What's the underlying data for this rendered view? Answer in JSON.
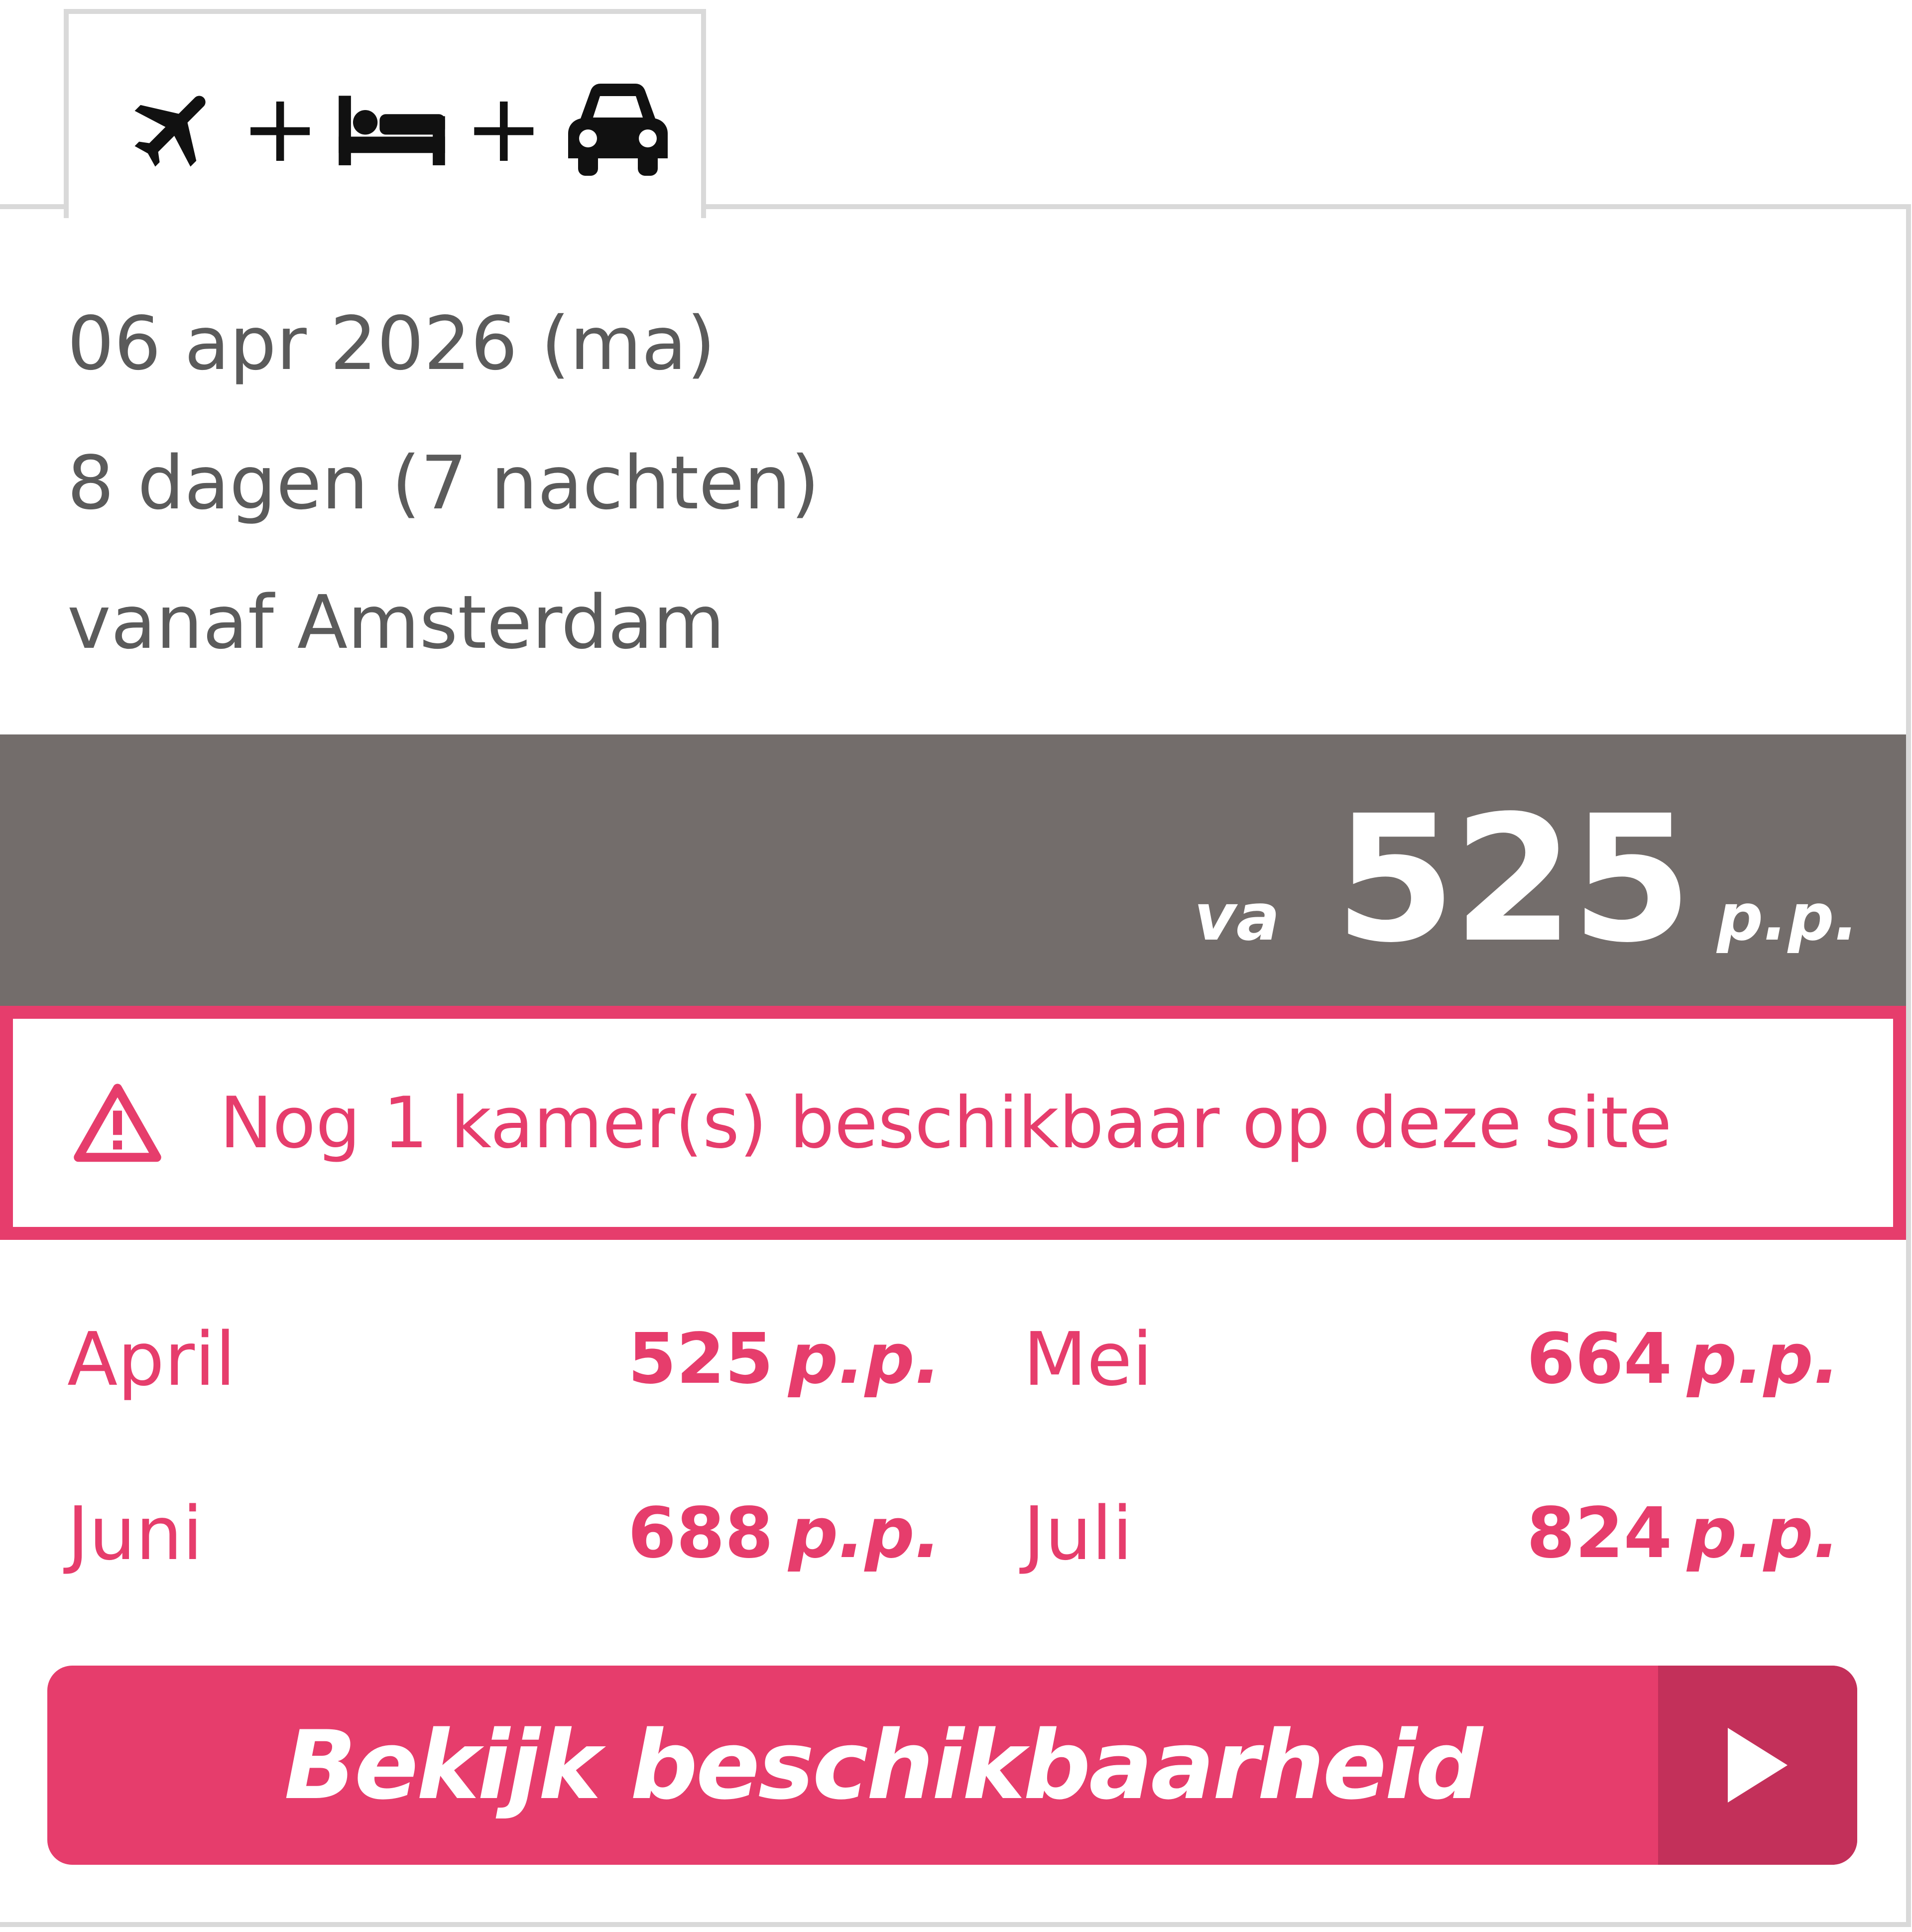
{
  "tab": {
    "icons": [
      "plane-icon",
      "bed-icon",
      "car-icon"
    ],
    "plus": "+"
  },
  "trip": {
    "date": "06 apr 2026 (ma)",
    "duration": "8 dagen (7 nachten)",
    "departure": "vanaf Amsterdam"
  },
  "price": {
    "prefix": "va",
    "amount": "525",
    "suffix": "p.p."
  },
  "alert": {
    "icon": "warning-icon",
    "message": "Nog 1 kamer(s) beschikbaar op deze site"
  },
  "months": [
    {
      "name": "April",
      "price": "525",
      "suffix": "p.p."
    },
    {
      "name": "Mei",
      "price": "664",
      "suffix": "p.p."
    },
    {
      "name": "Juni",
      "price": "688",
      "suffix": "p.p."
    },
    {
      "name": "Juli",
      "price": "824",
      "suffix": "p.p."
    }
  ],
  "cta": {
    "label": "Bekijk beschikbaarheid",
    "icon": "play-arrow-icon"
  },
  "colors": {
    "accent": "#e63d6c",
    "accent_dark": "#c3305a",
    "band": "#736d6b",
    "text": "#5b5b5b",
    "border": "#d9d9d9"
  }
}
